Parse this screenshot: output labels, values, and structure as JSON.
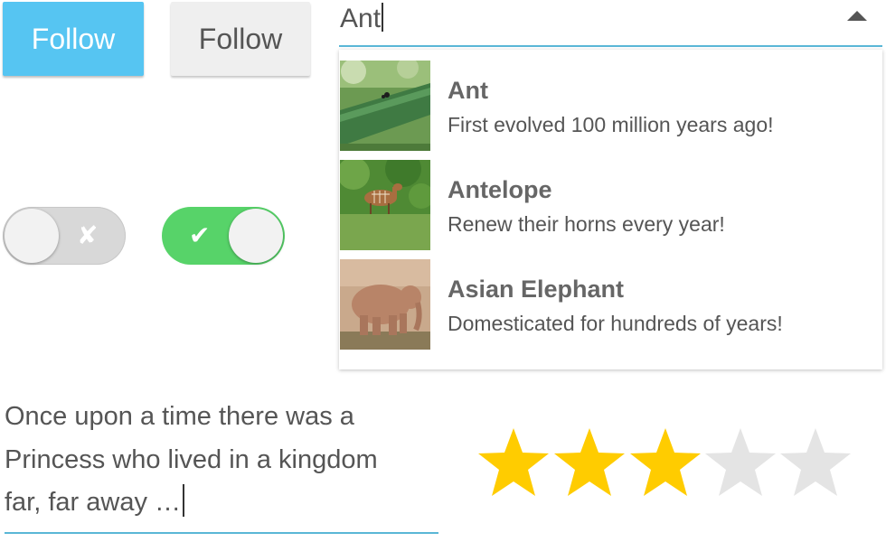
{
  "buttons": {
    "follow_primary_label": "Follow",
    "follow_secondary_label": "Follow",
    "primary_color": "#56c5f2"
  },
  "toggles": {
    "off_glyph": "✘",
    "on_glyph": "✔",
    "off_state": false,
    "on_state": true,
    "on_color": "#57d369",
    "off_color": "#d8d8d8"
  },
  "search": {
    "value": "Ant",
    "toggle_icon": "triangle-up-icon"
  },
  "dropdown": {
    "items": [
      {
        "title": "Ant",
        "description": "First evolved 100 million years ago!",
        "image": "ant-photo"
      },
      {
        "title": "Antelope",
        "description": "Renew their horns every year!",
        "image": "antelope-photo"
      },
      {
        "title": "Asian Elephant",
        "description": "Domesticated for hundreds of years!",
        "image": "elephant-photo"
      }
    ]
  },
  "story": {
    "text": "Once upon a time there was a\nPrincess who lived in a kingdom\nfar, far away …"
  },
  "rating": {
    "value": 3,
    "max": 5,
    "filled_color": "#ffcc00",
    "empty_color": "#e4e4e4"
  }
}
